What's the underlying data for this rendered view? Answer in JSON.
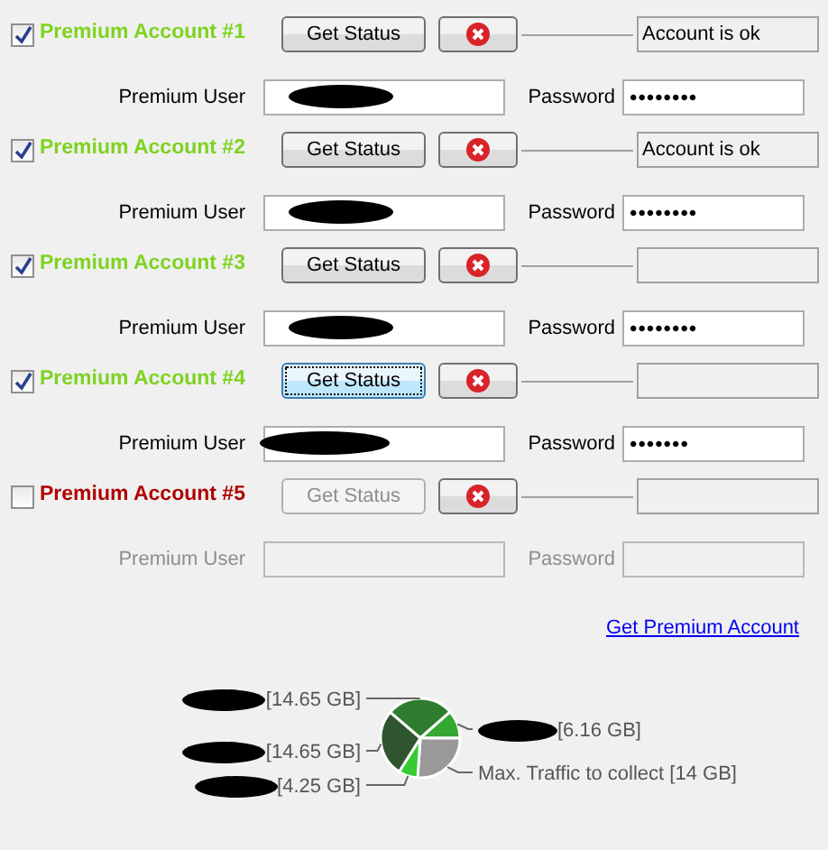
{
  "accounts": [
    {
      "title": "Premium Account #1",
      "checked": true,
      "status_button": {
        "label": "Get Status",
        "focused": false
      },
      "status": "Account is ok",
      "user_label": "Premium User",
      "user_redacted": true,
      "password_label": "Password",
      "password": "••••••••"
    },
    {
      "title": "Premium Account #2",
      "checked": true,
      "status_button": {
        "label": "Get Status",
        "focused": false
      },
      "status": "Account is ok",
      "user_label": "Premium User",
      "user_redacted": true,
      "password_label": "Password",
      "password": "••••••••"
    },
    {
      "title": "Premium Account #3",
      "checked": true,
      "status_button": {
        "label": "Get Status",
        "focused": false
      },
      "user_label": "Premium User",
      "user_redacted": true,
      "password_label": "Password",
      "password": "••••••••"
    },
    {
      "title": "Premium Account #4",
      "checked": true,
      "status_button": {
        "label": "Get Status",
        "focused": true
      },
      "user_label": "Premium User",
      "user_redacted": true,
      "password_label": "Password",
      "password": "•••••••"
    },
    {
      "title": "Premium Account #5",
      "checked": false,
      "status_button": {
        "label": "Get Status",
        "focused": false
      },
      "user_label": "Premium User",
      "user_redacted": false,
      "password_label": "Password"
    }
  ],
  "link": "Get Premium Account",
  "traffic": {
    "chart_data": {
      "type": "pie",
      "categories": [
        "[14.65 GB]",
        "[6.16 GB]",
        "Max. Traffic to collect [14 GB]",
        "[4.25 GB]",
        "[14.65 GB]"
      ],
      "values": [
        14.65,
        6.16,
        14,
        4.25,
        14.65
      ],
      "colors": [
        "#2e7d2e",
        "#33a833",
        "#999999",
        "#33cc33",
        "#2f552f"
      ]
    },
    "label_redacted": [
      true,
      true,
      false,
      true,
      true
    ]
  }
}
